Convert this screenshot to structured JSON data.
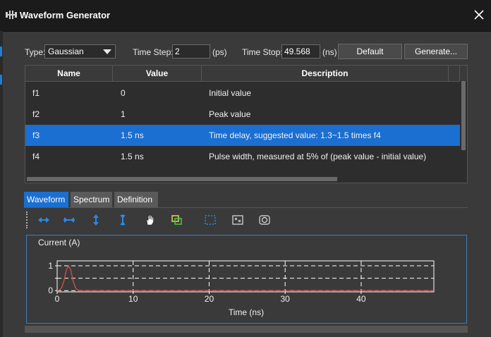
{
  "window": {
    "title": "Waveform Generator"
  },
  "controls": {
    "type_label": "Type:",
    "type_value": "Gaussian",
    "time_step_label": "Time Step:",
    "time_step_value": "2",
    "time_step_unit": "(ps)",
    "time_stop_label": "Time Stop:",
    "time_stop_value": "49.568",
    "time_stop_unit": "(ns)",
    "default_label": "Default",
    "generate_label": "Generate..."
  },
  "table": {
    "columns": [
      "Name",
      "Value",
      "Description"
    ],
    "rows": [
      {
        "name": "f1",
        "value": "0",
        "description": "Initial value"
      },
      {
        "name": "f2",
        "value": "1",
        "description": "Peak value"
      },
      {
        "name": "f3",
        "value": "1.5 ns",
        "description": "Time delay, suggested value: 1.3~1.5 times f4"
      },
      {
        "name": "f4",
        "value": "1.5 ns",
        "description": "Pulse width, measured at 5% of (peak value - initial value)"
      }
    ],
    "selected_row": 2
  },
  "tabs": [
    {
      "label": "Waveform",
      "active": true
    },
    {
      "label": "Spectrum",
      "active": false
    },
    {
      "label": "Definition",
      "active": false
    }
  ],
  "toolbar_icons": [
    "zoom-in-x-icon",
    "zoom-out-x-icon",
    "zoom-in-y-icon",
    "zoom-out-y-icon",
    "pan-hand-icon",
    "zoom-fit-icon",
    "select-box-icon",
    "zoom-box-icon",
    "reset-view-icon"
  ],
  "colors": {
    "accent": "#1a6fd1",
    "curve": "#e05050",
    "grid": "#ffffff"
  },
  "chart_data": {
    "type": "line",
    "ylabel": "Current (A)",
    "xlabel": "Time (ns)",
    "xlim": [
      0,
      49.568
    ],
    "ylim": [
      -0.05,
      1.2
    ],
    "xticks": [
      "0",
      "10",
      "20",
      "30",
      "40"
    ],
    "yticks": [
      "0",
      "0.5",
      "1"
    ],
    "grid": true,
    "series": [
      {
        "x": [
          0,
          0.3,
          0.6,
          0.9,
          1.2,
          1.5,
          1.8,
          2.1,
          2.4,
          2.7,
          3.0,
          3.5,
          4.0,
          49.568
        ],
        "y": [
          0,
          0.02,
          0.12,
          0.4,
          0.82,
          1.0,
          0.82,
          0.4,
          0.12,
          0.02,
          0.0,
          0,
          0,
          0
        ]
      }
    ]
  }
}
